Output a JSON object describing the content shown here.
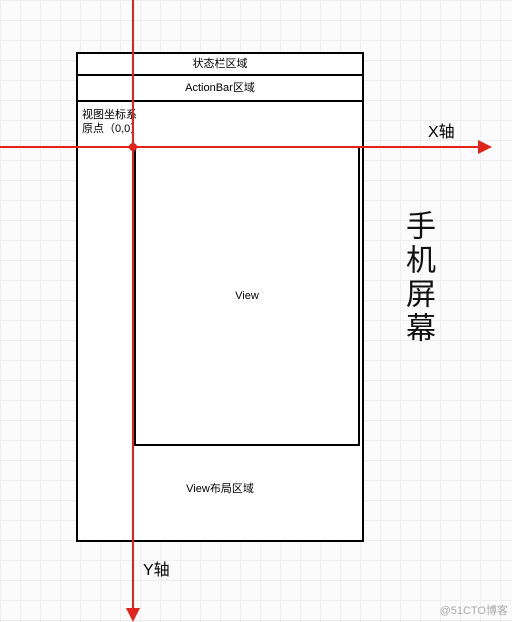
{
  "layout": {
    "status_bar_label": "状态栏区域",
    "action_bar_label": "ActionBar区域",
    "origin_line1": "视图坐标系",
    "origin_line2": "原点（0,0）",
    "view_label": "View",
    "view_layout_label": "View布局区域"
  },
  "axes": {
    "x_label": "X轴",
    "y_label": "Y轴"
  },
  "captions": {
    "phone_screen": "手机屏幕"
  },
  "watermark": "@51CTO博客"
}
